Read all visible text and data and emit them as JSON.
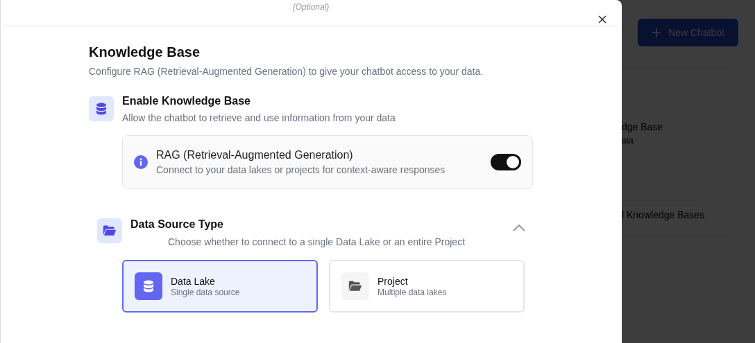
{
  "modal": {
    "header_hint": "(Optional)",
    "title": "Knowledge Base",
    "description": "Configure RAG (Retrieval-Augmented Generation) to give your chatbot access to your data."
  },
  "knowledge_base": {
    "title": "Enable Knowledge Base",
    "description": "Allow the chatbot to retrieve and use information from your data",
    "rag": {
      "title": "RAG (Retrieval-Augmented Generation)",
      "description": "Connect to your data lakes or projects for context-aware responses",
      "on": true
    }
  },
  "data_source": {
    "title": "Data Source Type",
    "description": "Choose whether to connect to a single Data Lake or an entire Project",
    "expanded": true,
    "options": [
      {
        "kind": "data_lake",
        "label": "Data Lake",
        "caption": "Single data source",
        "selected": true
      },
      {
        "kind": "project",
        "label": "Project",
        "caption": "Multiple data lakes",
        "selected": false
      }
    ]
  },
  "background": {
    "new_chatbot_button": "New Chatbot",
    "card_title": "dge Base",
    "card_subtitle": "ata",
    "filter_dropdown": "l Knowledge Bases"
  }
}
